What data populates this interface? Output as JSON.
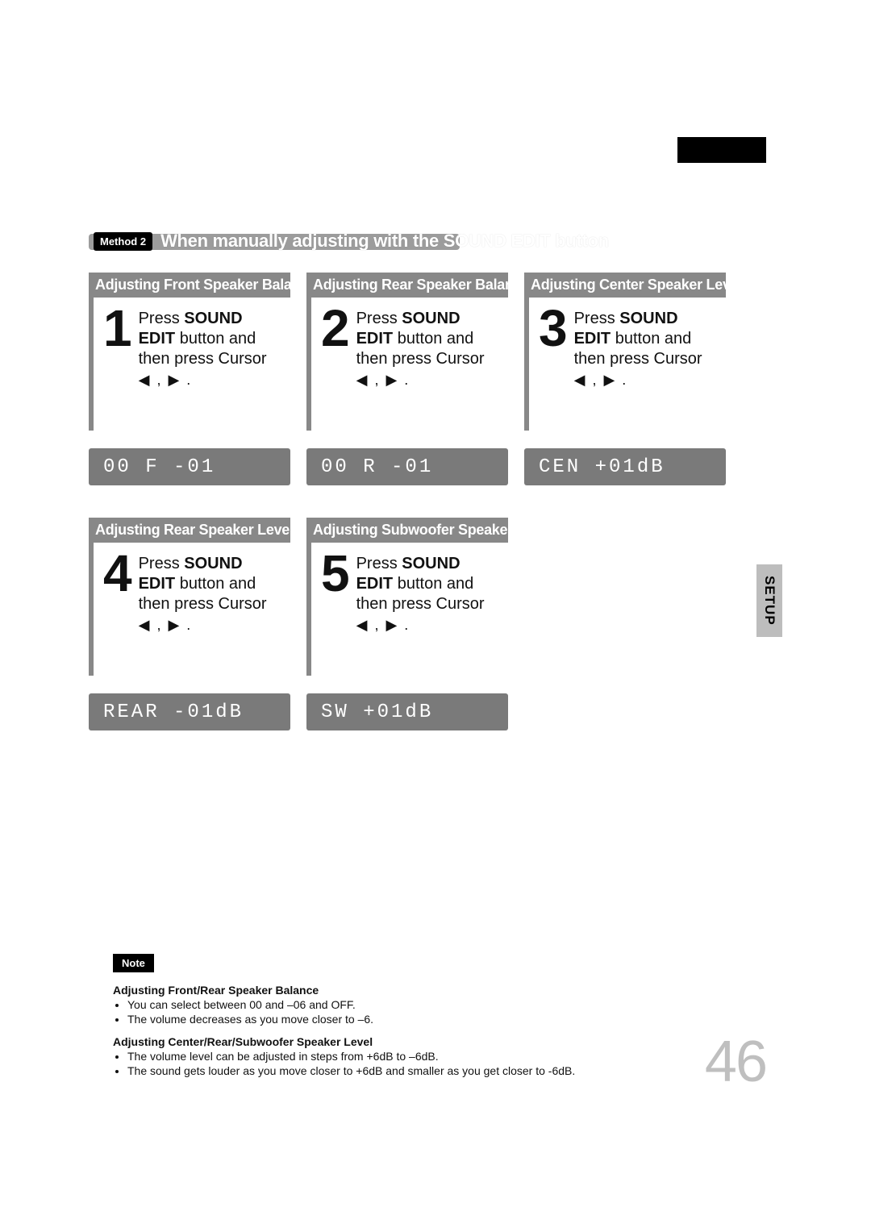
{
  "tab_label": "SETUP",
  "page_number": "46",
  "method": {
    "pill": "Method 2",
    "title": "When manually adjusting with the SOUND EDIT button"
  },
  "step_instruction": {
    "line1a": "Press ",
    "line1b": "SOUND",
    "line2a": "EDIT",
    "line2b": " button and",
    "line3": "then press Cursor",
    "cursor_glyphs": "◀ , ▶ ."
  },
  "steps": [
    {
      "num": "1",
      "heading": "Adjusting Front Speaker Balance",
      "lcd": "00 F  -01"
    },
    {
      "num": "2",
      "heading": "Adjusting Rear Speaker Balance",
      "lcd": "00 R  -01"
    },
    {
      "num": "3",
      "heading": "Adjusting Center Speaker Level",
      "lcd": "CEN  +01dB"
    },
    {
      "num": "4",
      "heading": "Adjusting Rear Speaker Level",
      "lcd": "REAR -01dB"
    },
    {
      "num": "5",
      "heading": "Adjusting Subwoofer Speaker Level",
      "lcd": "SW   +01dB"
    }
  ],
  "notes": {
    "pill": "Note",
    "section1_heading": "Adjusting Front/Rear Speaker Balance",
    "section1_items": [
      "You can select between 00 and –06 and OFF.",
      "The volume decreases as you move closer to –6."
    ],
    "section2_heading": "Adjusting Center/Rear/Subwoofer Speaker Level",
    "section2_items": [
      "The volume level can be adjusted in steps from +6dB to –6dB.",
      "The sound gets louder as you move closer to +6dB and smaller as you get closer to -6dB."
    ]
  }
}
